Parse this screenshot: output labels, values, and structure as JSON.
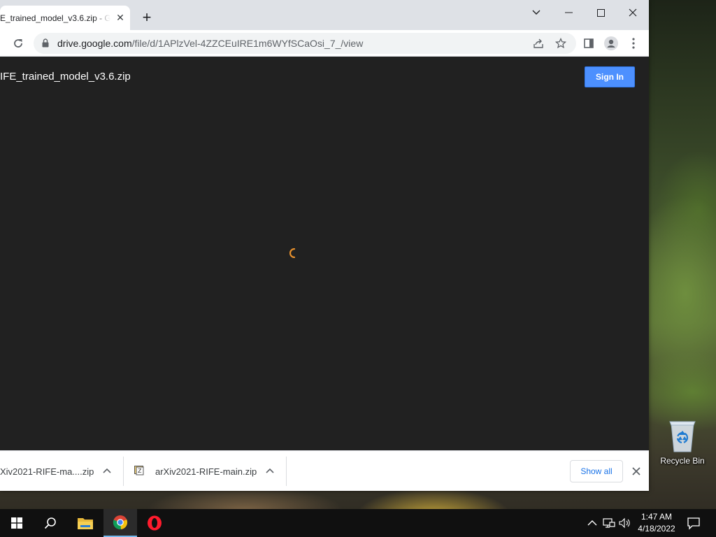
{
  "browser": {
    "tab": {
      "title": "E_trained_model_v3.6.zip - Go"
    },
    "url": {
      "domain": "drive.google.com",
      "path": "/file/d/1APlzVel-4ZZCEuIRE1m6WYfSCaOsi_7_/view"
    }
  },
  "page": {
    "file_title": "IFE_trained_model_v3.6.zip",
    "signin_label": "Sign In"
  },
  "downloads": {
    "items": [
      {
        "name": "Xiv2021-RIFE-ma....zip"
      },
      {
        "name": "arXiv2021-RIFE-main.zip"
      }
    ],
    "show_all_label": "Show all"
  },
  "desktop": {
    "recycle_bin_label": "Recycle Bin"
  },
  "taskbar": {
    "time": "1:47 AM",
    "date": "4/18/2022"
  },
  "colors": {
    "accent_blue": "#4d90fe",
    "spinner_orange": "#e8912d",
    "page_bg": "#212121"
  }
}
